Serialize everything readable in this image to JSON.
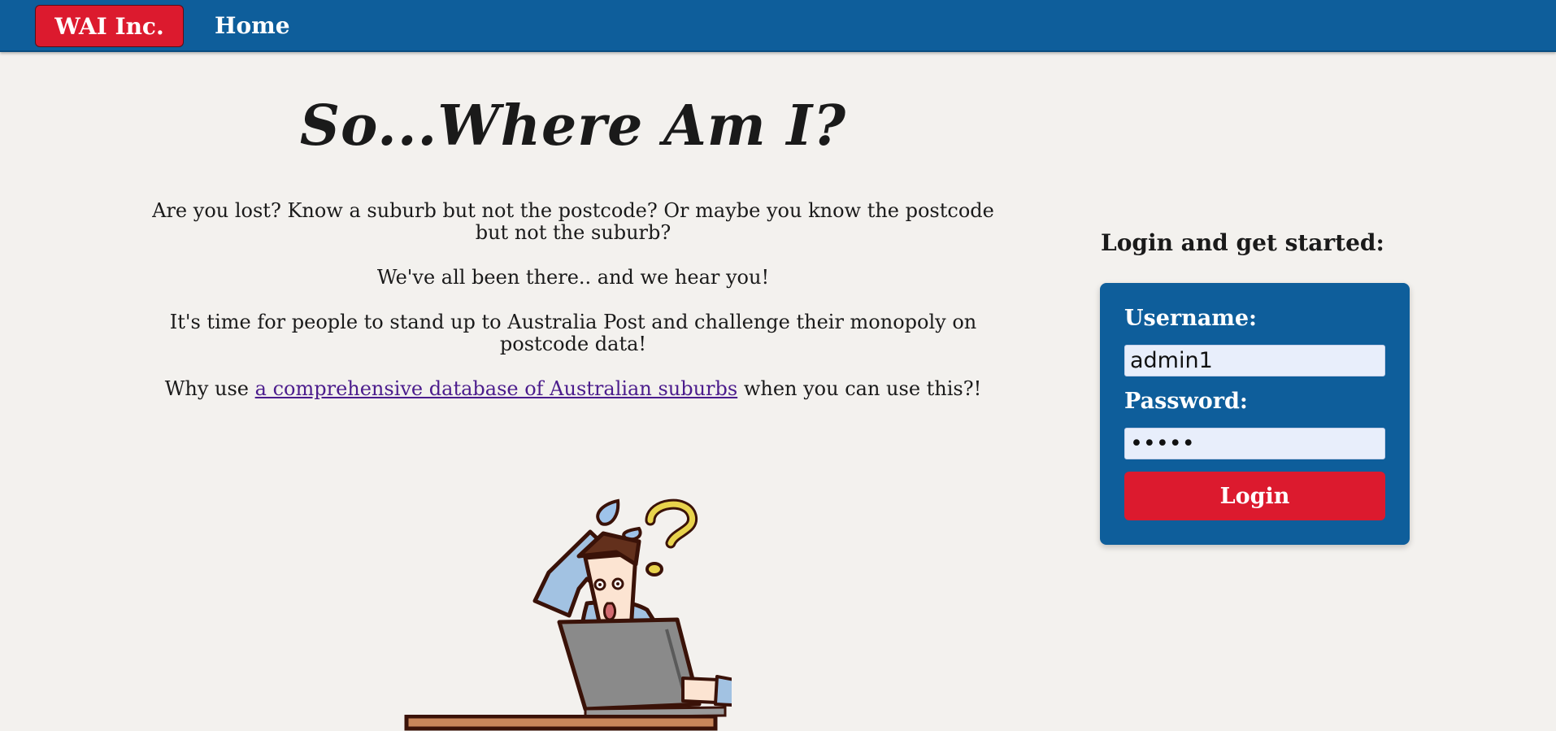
{
  "nav": {
    "brand": "WAI Inc.",
    "home": "Home"
  },
  "main": {
    "title": "So...Where Am I?",
    "paragraph1": "Are you lost? Know a suburb but not the postcode? Or maybe you know the postcode but not the suburb?",
    "paragraph2": "We've all been there.. and we hear you!",
    "paragraph3": "It's time for people to stand up to Australia Post and challenge their monopoly on postcode data!",
    "paragraph4_prefix": "Why use ",
    "paragraph4_link": "a comprehensive database of Australian suburbs",
    "paragraph4_suffix": " when you can use this?!",
    "illustration": "confused-person-laptop-icon"
  },
  "login": {
    "heading": "Login and get started:",
    "username_label": "Username:",
    "username_value": "admin1",
    "password_label": "Password:",
    "password_value": "•••••",
    "button": "Login"
  },
  "colors": {
    "navbar": "#0e5e9b",
    "brand_red": "#dc1a2e",
    "background": "#f3f1ee",
    "link": "#4b1c8c"
  }
}
